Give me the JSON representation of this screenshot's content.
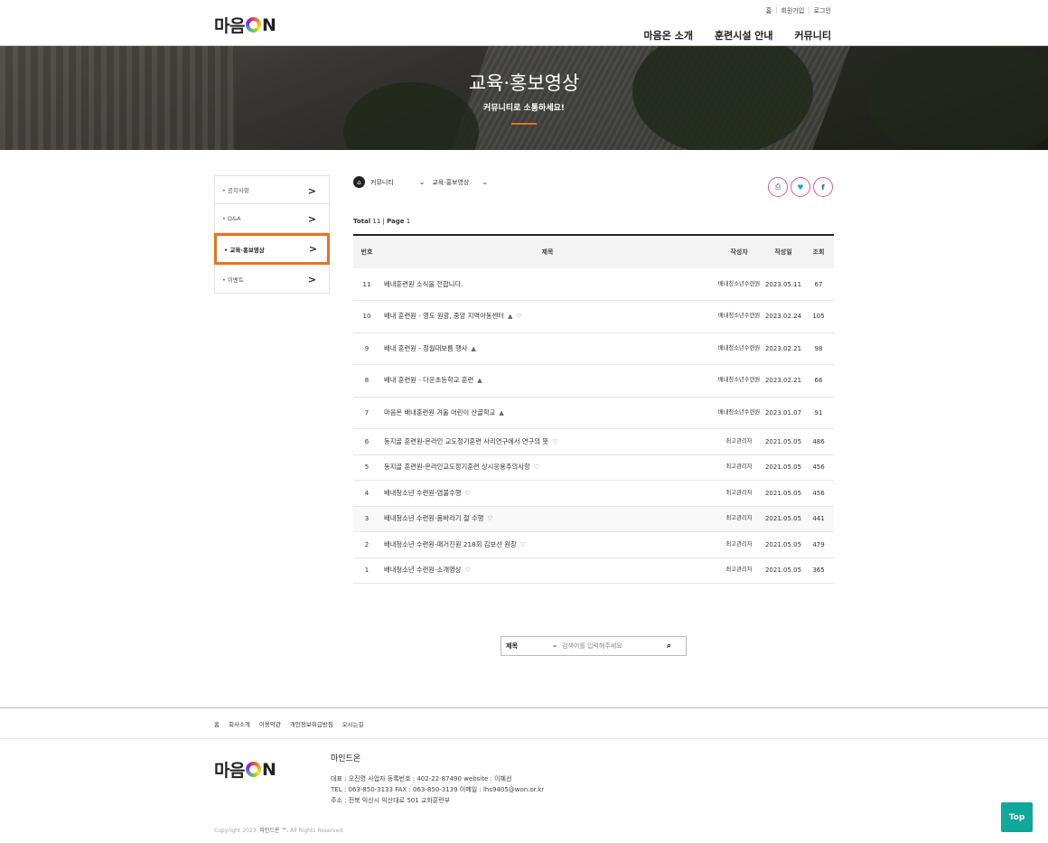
{
  "header": {
    "logo_text_pre": "마음",
    "logo_text_post": "N",
    "util_links": [
      "홈",
      "회원가입",
      "로그인"
    ],
    "gnb": [
      "마음온 소개",
      "훈련시설 안내",
      "커뮤니티"
    ]
  },
  "banner": {
    "title": "교육·홍보영상",
    "subtitle": "커뮤니티로 소통하세요!"
  },
  "lnb": {
    "items": [
      {
        "label": "공지사항"
      },
      {
        "label": "Q&A"
      },
      {
        "label": "교육·홍보영상"
      },
      {
        "label": "이벤트"
      }
    ],
    "active_index": 2
  },
  "location": {
    "level1": "커뮤니티",
    "level2": "교육·홍보영상"
  },
  "summary": {
    "total_label": "Total",
    "total": "11",
    "page_label": "Page",
    "page": "1"
  },
  "table": {
    "headers": {
      "num": "번호",
      "subject": "제목",
      "writer": "작성자",
      "date": "작성일",
      "views": "조회"
    },
    "rows": [
      {
        "num": "11",
        "subject": "배내훈련원 소식을 전합니다.",
        "writer": "배내청소년수련원",
        "date": "2023.05.11",
        "views": "67",
        "icon": ""
      },
      {
        "num": "10",
        "subject": "배내 훈련원 - 영도 원광, 중앙 지역아동센터",
        "writer": "배내청소년수련원",
        "date": "2023.02.24",
        "views": "105",
        "icon": "attach-heart"
      },
      {
        "num": "9",
        "subject": "배내 훈련원 - 정월대보름 행사",
        "writer": "배내청소년수련원",
        "date": "2023.02.21",
        "views": "98",
        "icon": "attach"
      },
      {
        "num": "8",
        "subject": "배내 훈련원 - 다운초등학교 훈련",
        "writer": "배내청소년수련원",
        "date": "2023.02.21",
        "views": "66",
        "icon": "attach"
      },
      {
        "num": "7",
        "subject": "마음온 배내훈련원 겨울 어린이 산골학교",
        "writer": "배내청소년수련원",
        "date": "2023.01.07",
        "views": "91",
        "icon": "attach"
      },
      {
        "num": "6",
        "subject": "동지골 훈련원-온라인 교도정기훈련 사리연구에서 연구의 뜻",
        "writer": "최고관리자",
        "date": "2021.05.05",
        "views": "486",
        "icon": "heart"
      },
      {
        "num": "5",
        "subject": "동지골 훈련원-온라인교도정기훈련 상시응용주의사항",
        "writer": "최고관리자",
        "date": "2021.05.05",
        "views": "456",
        "icon": "heart"
      },
      {
        "num": "4",
        "subject": "배내청소년 수련원-염불수행",
        "writer": "최고관리자",
        "date": "2021.05.05",
        "views": "456",
        "icon": "heart"
      },
      {
        "num": "3",
        "subject": "배내청소년 수련원-몸바라기 철 수행",
        "writer": "최고관리자",
        "date": "2021.05.05",
        "views": "441",
        "icon": "heart"
      },
      {
        "num": "2",
        "subject": "배내청소년 수련원-매거진원 218회 김보선 원장",
        "writer": "최고관리자",
        "date": "2021.05.05",
        "views": "479",
        "icon": "heart"
      },
      {
        "num": "1",
        "subject": "배내청소년 수련원-소개영상",
        "writer": "최고관리자",
        "date": "2021.05.05",
        "views": "365",
        "icon": "heart"
      }
    ]
  },
  "search": {
    "field": "제목",
    "placeholder": "검색어를 입력해주세요"
  },
  "footer": {
    "links": [
      "홈",
      "회사소개",
      "이용약관",
      "개인정보취급방침",
      "오시는길"
    ],
    "company": "마인드온",
    "info_lines": [
      "대표 : 오진명    사업자 등록번호 : 402-22-87490    website : 이혜선",
      "TEL : 063-850-3133    FAX : 063-850-3139    이메일 : lhs9405@won.or.kr",
      "주소 : 전북 익산시 익산대로 501 교화훈련부"
    ],
    "copyright_pre": "Copyright 2023.",
    "copyright_brand": "마인드온 ™.",
    "copyright_post": "All Rights Reserved.",
    "top_label": "Top"
  },
  "colors": {
    "accent": "#e8731e",
    "top_button": "#0fa89a",
    "share_border": "#e45a8b"
  }
}
